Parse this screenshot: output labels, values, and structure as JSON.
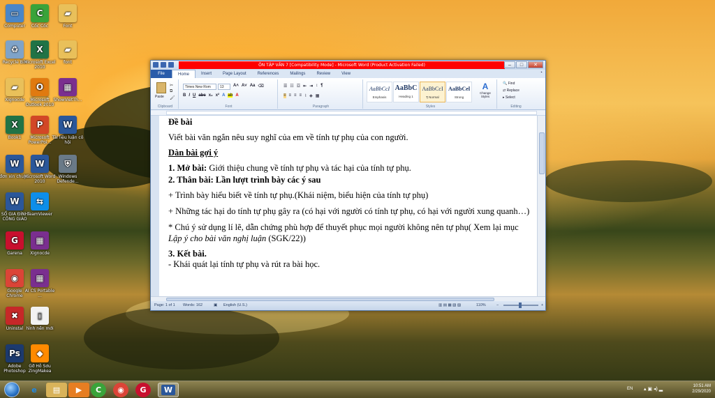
{
  "desktop_icons": [
    {
      "label": "Computer",
      "icon": "computer-icon",
      "color": "#4a86c8"
    },
    {
      "label": "Cốc Cốc",
      "icon": "coccoc-icon",
      "color": "#3aa33a"
    },
    {
      "label": "Font",
      "icon": "folder-icon",
      "color": "#e9c05a"
    },
    {
      "label": "Recycle Bin",
      "icon": "recycle-bin-icon",
      "color": "#7fa3c8"
    },
    {
      "label": "Microsoft Excel 2010",
      "icon": "excel-icon",
      "color": "#217346"
    },
    {
      "label": "font",
      "icon": "folder-icon",
      "color": "#e9c05a"
    },
    {
      "label": "Xignocde",
      "icon": "folder-icon",
      "color": "#e9c05a"
    },
    {
      "label": "Microsoft Outlook 2010",
      "icon": "outlook-icon",
      "color": "#e07a10"
    },
    {
      "label": "ShowVietTh...",
      "icon": "winrar-icon",
      "color": "#7a2f8f"
    },
    {
      "label": "Book1",
      "icon": "excel-file-icon",
      "color": "#217346"
    },
    {
      "label": "Microsoft PowerPoi...",
      "icon": "powerpoint-icon",
      "color": "#d24726"
    },
    {
      "label": "Tài liệu luận cô hội",
      "icon": "word-file-icon",
      "color": "#2b579a"
    },
    {
      "label": "đơn xin chuy...",
      "icon": "word-file-icon",
      "color": "#2b579a"
    },
    {
      "label": "Microsoft Word 2010",
      "icon": "word-icon",
      "color": "#2b579a"
    },
    {
      "label": "Windows Defende...",
      "icon": "defender-icon",
      "color": "#6a7a88"
    },
    {
      "label": "SỔ GIA ĐÌNH CÔNG GIÁO",
      "icon": "word-file-icon",
      "color": "#2b579a"
    },
    {
      "label": "TeamViewer",
      "icon": "teamviewer-icon",
      "color": "#0e8ee9"
    },
    {
      "label": "Garena",
      "icon": "garena-icon",
      "color": "#c8102e"
    },
    {
      "label": "Xignocde",
      "icon": "winrar-icon",
      "color": "#7a2f8f"
    },
    {
      "label": "Google Chrome",
      "icon": "chrome-icon",
      "color": "#db4437"
    },
    {
      "label": "AI CS Portable ...",
      "icon": "winrar-icon",
      "color": "#7a2f8f"
    },
    {
      "label": "Uninstal",
      "icon": "uninstall-icon",
      "color": "#c62828"
    },
    {
      "label": "hình nền mới",
      "icon": "file-icon",
      "color": "#f2f2f2"
    },
    {
      "label": "Adobe Photoshop",
      "icon": "photoshop-icon",
      "color": "#1c3a6e"
    },
    {
      "label": "Gỡ Hỗ Sơu ZingMakea",
      "icon": "document-icon",
      "color": "#ff8a00"
    }
  ],
  "word": {
    "title": "ÔN TẬP VĂN 7 [Compatibility Mode] - Microsoft Word (Product Activation Failed)",
    "tabs": [
      "File",
      "Home",
      "Insert",
      "Page Layout",
      "References",
      "Mailings",
      "Review",
      "View"
    ],
    "active_tab": "Home",
    "ribbon": {
      "clipboard_label": "Clipboard",
      "paste_label": "Paste",
      "font_label": "Font",
      "font_name": "Times New Rom",
      "font_size": "13",
      "paragraph_label": "Paragraph",
      "styles_label": "Styles",
      "styles": [
        {
          "preview": "AaBbCcI",
          "name": "Emphasis"
        },
        {
          "preview": "AaBbC",
          "name": "Heading 1"
        },
        {
          "preview": "AaBbCcI",
          "name": "¶ Normal"
        },
        {
          "preview": "AaBbCel",
          "name": "Strong"
        }
      ],
      "change_styles_label": "Change Styles",
      "editing_label": "Editing",
      "find_label": "Find",
      "replace_label": "Replace",
      "select_label": "Select"
    },
    "document": {
      "heading": "Đề bài",
      "prompt": "Viết bài văn ngắn nêu suy nghĩ của em về tính tự phụ của con người.",
      "outline_heading": "Dàn bài gợi ý",
      "intro_bold": "1. Mở bài:",
      "intro_text": " Giới thiệu chung về tính tự phụ và tác hại của tính tự phụ.",
      "body_heading": "2. Thân bài: Lần lượt trình bày các ý sau",
      "point1": "+ Trình bày hiểu biết về tính tự phụ.(Khái niệm, biểu hiện của tính tự phụ)",
      "point2": "+ Những tác hại do tính tự phụ gây ra (có hại với người có tính tự phụ, có hại với người xung quanh…)",
      "note_pre": "* Chú ý sử dụng lí lẽ, dẫn chứng phù hợp để thuyết phục mọi người không nên tự phụ( Xem lại mục ",
      "note_italic": "Lập ý cho bài văn nghị luận",
      "note_post": " (SGK/22))",
      "conclusion_heading": "3. Kết bài.",
      "conclusion_text": "- Khái quát lại tính tự phụ và rút ra bài học."
    },
    "status": {
      "page": "Page: 1 of 1",
      "words": "Words: 162",
      "language": "English (U.S.)",
      "zoom": "110%"
    }
  },
  "taskbar": {
    "language": "EN",
    "time": "10:51 AM",
    "date": "2/29/2020"
  }
}
